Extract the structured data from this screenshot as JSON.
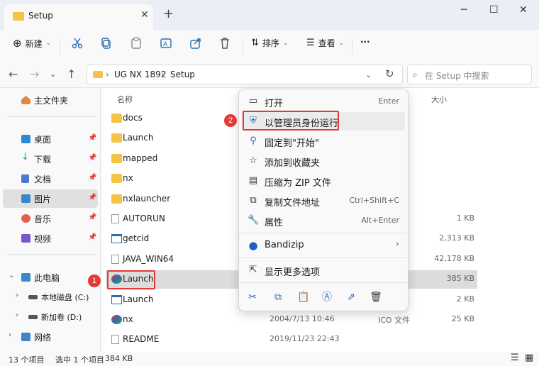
{
  "window": {
    "tab_title": "Setup",
    "controls": [
      "─",
      "☐",
      "✕"
    ]
  },
  "toolbar": {
    "new_label": "新建",
    "sort_label": "排序",
    "view_label": "查看",
    "more_label": "···"
  },
  "address": {
    "crumbs": [
      "UG NX 1892",
      "Setup"
    ],
    "search_placeholder": "在 Setup 中搜索"
  },
  "sidebar": {
    "home": "主文件夹",
    "items": [
      {
        "label": "桌面",
        "color": "#2a8bd0"
      },
      {
        "label": "下载",
        "color": "#2aa84f"
      },
      {
        "label": "文档",
        "color": "#4a79c9"
      },
      {
        "label": "图片",
        "color": "#3b86c9"
      },
      {
        "label": "音乐",
        "color": "#e1604c"
      },
      {
        "label": "视频",
        "color": "#7a57c9"
      }
    ],
    "this_pc": "此电脑",
    "drives": [
      "本地磁盘 (C:)",
      "新加卷 (D:)"
    ],
    "network": "网络"
  },
  "columns": {
    "name": "名称",
    "size": "大小"
  },
  "files": [
    {
      "name": "docs",
      "date": "",
      "type": "",
      "size": "",
      "kind": "folder"
    },
    {
      "name": "Launch",
      "date": "",
      "type": "",
      "size": "",
      "kind": "folder"
    },
    {
      "name": "mapped",
      "date": "",
      "type": "",
      "size": "",
      "kind": "folder"
    },
    {
      "name": "nx",
      "date": "",
      "type": "",
      "size": "",
      "kind": "folder"
    },
    {
      "name": "nxlauncher",
      "date": "",
      "type": "",
      "size": "",
      "kind": "folder"
    },
    {
      "name": "AUTORUN",
      "date": "",
      "type": "",
      "size": "1 KB",
      "kind": "file"
    },
    {
      "name": "getcid",
      "date": "",
      "type": "",
      "size": "2,313 KB",
      "kind": "exe"
    },
    {
      "name": "JAVA_WIN64",
      "date": "",
      "type": "",
      "size": "42,178 KB",
      "kind": "file"
    },
    {
      "name": "Launch",
      "date": "",
      "type": "",
      "size": "385 KB",
      "kind": "app"
    },
    {
      "name": "Launch",
      "date": "",
      "type": "序",
      "size": "2 KB",
      "kind": "exe"
    },
    {
      "name": "nx",
      "date": "2004/7/13 10:46",
      "type": "ICO 文件",
      "size": "25 KB",
      "kind": "app"
    },
    {
      "name": "README",
      "date": "2019/11/23 22:43",
      "type": "",
      "size": "",
      "kind": "file"
    }
  ],
  "context_menu": {
    "items": [
      {
        "label": "打开",
        "key": "Enter",
        "icon": "open-icon"
      },
      {
        "label": "以管理员身份运行",
        "key": "",
        "icon": "shield-icon"
      },
      {
        "label": "固定到\"开始\"",
        "key": "",
        "icon": "pin-icon"
      },
      {
        "label": "添加到收藏夹",
        "key": "",
        "icon": "star-icon"
      },
      {
        "label": "压缩为 ZIP 文件",
        "key": "",
        "icon": "zip-icon"
      },
      {
        "label": "复制文件地址",
        "key": "Ctrl+Shift+C",
        "icon": "copy-path-icon"
      },
      {
        "label": "属性",
        "key": "Alt+Enter",
        "icon": "wrench-icon"
      },
      {
        "label": "Bandizip",
        "key": "",
        "icon": "bandizip-icon"
      },
      {
        "label": "显示更多选项",
        "key": "",
        "icon": "more-options-icon"
      }
    ]
  },
  "annotations": {
    "badge1": "1",
    "badge2": "2",
    "accent": "#e53935"
  },
  "status": {
    "count": "13 个项目",
    "selected": "选中 1 个项目",
    "size": "384 KB"
  }
}
